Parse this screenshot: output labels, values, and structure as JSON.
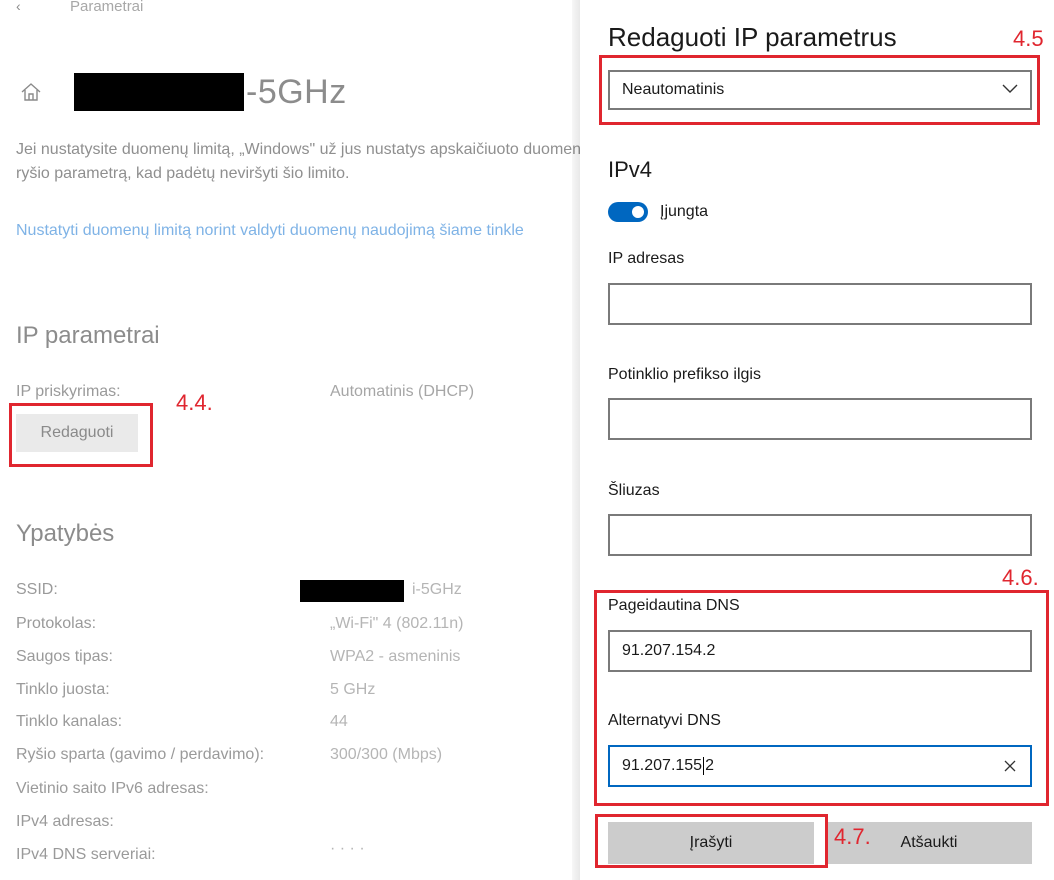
{
  "left": {
    "breadcrumb": "Parametrai",
    "network_name_suffix": "-5GHz",
    "description": "Jei nustatysite duomenų limitą, „Windows\" už jus nustatys apskaičiuoto duomenų ryšio parametrą, kad padėtų neviršyti šio limito.",
    "limit_link": "Nustatyti duomenų limitą norint valdyti duomenų naudojimą šiame tinkle",
    "ip_section_title": "IP parametrai",
    "ip_assign_label": "IP priskyrimas:",
    "ip_assign_value": "Automatinis (DHCP)",
    "edit_button": "Redaguoti",
    "props_title": "Ypatybės",
    "ssid_suffix": "i-5GHz",
    "properties": [
      {
        "label": "SSID:",
        "value": ""
      },
      {
        "label": "Protokolas:",
        "value": "„Wi-Fi\" 4 (802.11n)"
      },
      {
        "label": "Saugos tipas:",
        "value": "WPA2 - asmeninis"
      },
      {
        "label": "Tinklo juosta:",
        "value": "5 GHz"
      },
      {
        "label": "Tinklo kanalas:",
        "value": "44"
      },
      {
        "label": "Ryšio sparta (gavimo / perdavimo):",
        "value": "300/300 (Mbps)"
      },
      {
        "label": "Vietinio saito IPv6 adresas:",
        "value": ""
      },
      {
        "label": "IPv4 adresas:",
        "value": ""
      },
      {
        "label": "IPv4 DNS serveriai:",
        "value": "· · · ·"
      }
    ]
  },
  "panel": {
    "title": "Redaguoti IP parametrus",
    "mode_select": "Neautomatinis",
    "ipv4_heading": "IPv4",
    "toggle_label": "Įjungta",
    "ip_label": "IP adresas",
    "ip_value": "",
    "prefix_label": "Potinklio prefikso ilgis",
    "prefix_value": "",
    "gateway_label": "Šliuzas",
    "gateway_value": "",
    "dns_pref_label": "Pageidautina DNS",
    "dns_pref_value": "91.207.154.2",
    "dns_alt_label": "Alternatyvi DNS",
    "dns_alt_value_before_caret": "91.207.155",
    "dns_alt_value_after_caret": "2",
    "save_button": "Įrašyti",
    "cancel_button": "Atšaukti"
  },
  "annotations": {
    "step_44": "4.4.",
    "step_45": "4.5",
    "step_46": "4.6.",
    "step_47": "4.7."
  },
  "colors": {
    "accent": "#0067c0",
    "annotation_red": "#e0262f",
    "link": "#7fb3e6"
  }
}
